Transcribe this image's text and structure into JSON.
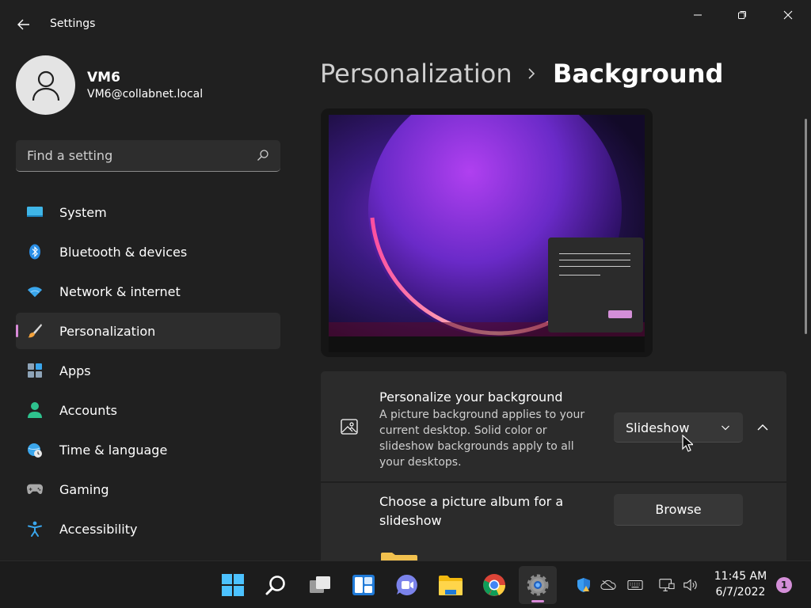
{
  "window": {
    "title": "Settings",
    "back_icon": "arrow-left-icon",
    "controls": [
      "minimize-icon",
      "maximize-icon",
      "close-icon"
    ]
  },
  "profile": {
    "name": "VM6",
    "email": "VM6@collabnet.local"
  },
  "search": {
    "placeholder": "Find a setting",
    "value": ""
  },
  "sidebar": {
    "items": [
      {
        "label": "System",
        "icon": "monitor-icon",
        "selected": false
      },
      {
        "label": "Bluetooth & devices",
        "icon": "bluetooth-icon",
        "selected": false
      },
      {
        "label": "Network & internet",
        "icon": "wifi-icon",
        "selected": false
      },
      {
        "label": "Personalization",
        "icon": "brush-icon",
        "selected": true
      },
      {
        "label": "Apps",
        "icon": "apps-icon",
        "selected": false
      },
      {
        "label": "Accounts",
        "icon": "person-icon",
        "selected": false
      },
      {
        "label": "Time & language",
        "icon": "globe-clock-icon",
        "selected": false
      },
      {
        "label": "Gaming",
        "icon": "gamepad-icon",
        "selected": false
      },
      {
        "label": "Accessibility",
        "icon": "accessibility-icon",
        "selected": false
      }
    ]
  },
  "breadcrumb": {
    "parent": "Personalization",
    "current": "Background"
  },
  "settings": {
    "personalize": {
      "title": "Personalize your background",
      "description": "A picture background applies to your current desktop. Solid color or slideshow backgrounds apply to all your desktops.",
      "selected": "Slideshow",
      "icon": "image-icon"
    },
    "album": {
      "title": "Choose a picture album for a slideshow",
      "button": "Browse"
    }
  },
  "taskbar": {
    "apps": [
      "windows-start-icon",
      "search-icon",
      "task-view-icon",
      "widgets-icon",
      "teams-chat-icon",
      "file-explorer-icon",
      "chrome-icon",
      "settings-icon"
    ],
    "active_app": "settings-icon",
    "time": "11:45 AM",
    "date": "6/7/2022",
    "notifications": "1"
  },
  "colors": {
    "accent": "#d88ad8",
    "background": "#202020",
    "card": "#2b2b2b"
  }
}
